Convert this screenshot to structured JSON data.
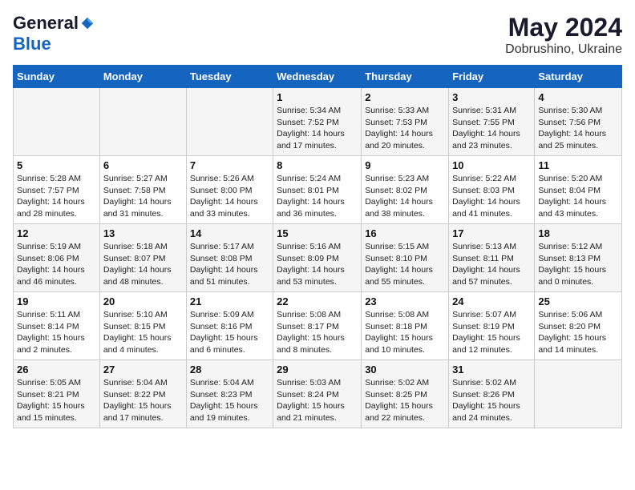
{
  "logo": {
    "general": "General",
    "blue": "Blue"
  },
  "title": "May 2024",
  "subtitle": "Dobrushino, Ukraine",
  "weekdays": [
    "Sunday",
    "Monday",
    "Tuesday",
    "Wednesday",
    "Thursday",
    "Friday",
    "Saturday"
  ],
  "weeks": [
    [
      null,
      null,
      null,
      {
        "day": "1",
        "sunrise": "Sunrise: 5:34 AM",
        "sunset": "Sunset: 7:52 PM",
        "daylight": "Daylight: 14 hours and 17 minutes."
      },
      {
        "day": "2",
        "sunrise": "Sunrise: 5:33 AM",
        "sunset": "Sunset: 7:53 PM",
        "daylight": "Daylight: 14 hours and 20 minutes."
      },
      {
        "day": "3",
        "sunrise": "Sunrise: 5:31 AM",
        "sunset": "Sunset: 7:55 PM",
        "daylight": "Daylight: 14 hours and 23 minutes."
      },
      {
        "day": "4",
        "sunrise": "Sunrise: 5:30 AM",
        "sunset": "Sunset: 7:56 PM",
        "daylight": "Daylight: 14 hours and 25 minutes."
      }
    ],
    [
      {
        "day": "5",
        "sunrise": "Sunrise: 5:28 AM",
        "sunset": "Sunset: 7:57 PM",
        "daylight": "Daylight: 14 hours and 28 minutes."
      },
      {
        "day": "6",
        "sunrise": "Sunrise: 5:27 AM",
        "sunset": "Sunset: 7:58 PM",
        "daylight": "Daylight: 14 hours and 31 minutes."
      },
      {
        "day": "7",
        "sunrise": "Sunrise: 5:26 AM",
        "sunset": "Sunset: 8:00 PM",
        "daylight": "Daylight: 14 hours and 33 minutes."
      },
      {
        "day": "8",
        "sunrise": "Sunrise: 5:24 AM",
        "sunset": "Sunset: 8:01 PM",
        "daylight": "Daylight: 14 hours and 36 minutes."
      },
      {
        "day": "9",
        "sunrise": "Sunrise: 5:23 AM",
        "sunset": "Sunset: 8:02 PM",
        "daylight": "Daylight: 14 hours and 38 minutes."
      },
      {
        "day": "10",
        "sunrise": "Sunrise: 5:22 AM",
        "sunset": "Sunset: 8:03 PM",
        "daylight": "Daylight: 14 hours and 41 minutes."
      },
      {
        "day": "11",
        "sunrise": "Sunrise: 5:20 AM",
        "sunset": "Sunset: 8:04 PM",
        "daylight": "Daylight: 14 hours and 43 minutes."
      }
    ],
    [
      {
        "day": "12",
        "sunrise": "Sunrise: 5:19 AM",
        "sunset": "Sunset: 8:06 PM",
        "daylight": "Daylight: 14 hours and 46 minutes."
      },
      {
        "day": "13",
        "sunrise": "Sunrise: 5:18 AM",
        "sunset": "Sunset: 8:07 PM",
        "daylight": "Daylight: 14 hours and 48 minutes."
      },
      {
        "day": "14",
        "sunrise": "Sunrise: 5:17 AM",
        "sunset": "Sunset: 8:08 PM",
        "daylight": "Daylight: 14 hours and 51 minutes."
      },
      {
        "day": "15",
        "sunrise": "Sunrise: 5:16 AM",
        "sunset": "Sunset: 8:09 PM",
        "daylight": "Daylight: 14 hours and 53 minutes."
      },
      {
        "day": "16",
        "sunrise": "Sunrise: 5:15 AM",
        "sunset": "Sunset: 8:10 PM",
        "daylight": "Daylight: 14 hours and 55 minutes."
      },
      {
        "day": "17",
        "sunrise": "Sunrise: 5:13 AM",
        "sunset": "Sunset: 8:11 PM",
        "daylight": "Daylight: 14 hours and 57 minutes."
      },
      {
        "day": "18",
        "sunrise": "Sunrise: 5:12 AM",
        "sunset": "Sunset: 8:13 PM",
        "daylight": "Daylight: 15 hours and 0 minutes."
      }
    ],
    [
      {
        "day": "19",
        "sunrise": "Sunrise: 5:11 AM",
        "sunset": "Sunset: 8:14 PM",
        "daylight": "Daylight: 15 hours and 2 minutes."
      },
      {
        "day": "20",
        "sunrise": "Sunrise: 5:10 AM",
        "sunset": "Sunset: 8:15 PM",
        "daylight": "Daylight: 15 hours and 4 minutes."
      },
      {
        "day": "21",
        "sunrise": "Sunrise: 5:09 AM",
        "sunset": "Sunset: 8:16 PM",
        "daylight": "Daylight: 15 hours and 6 minutes."
      },
      {
        "day": "22",
        "sunrise": "Sunrise: 5:08 AM",
        "sunset": "Sunset: 8:17 PM",
        "daylight": "Daylight: 15 hours and 8 minutes."
      },
      {
        "day": "23",
        "sunrise": "Sunrise: 5:08 AM",
        "sunset": "Sunset: 8:18 PM",
        "daylight": "Daylight: 15 hours and 10 minutes."
      },
      {
        "day": "24",
        "sunrise": "Sunrise: 5:07 AM",
        "sunset": "Sunset: 8:19 PM",
        "daylight": "Daylight: 15 hours and 12 minutes."
      },
      {
        "day": "25",
        "sunrise": "Sunrise: 5:06 AM",
        "sunset": "Sunset: 8:20 PM",
        "daylight": "Daylight: 15 hours and 14 minutes."
      }
    ],
    [
      {
        "day": "26",
        "sunrise": "Sunrise: 5:05 AM",
        "sunset": "Sunset: 8:21 PM",
        "daylight": "Daylight: 15 hours and 15 minutes."
      },
      {
        "day": "27",
        "sunrise": "Sunrise: 5:04 AM",
        "sunset": "Sunset: 8:22 PM",
        "daylight": "Daylight: 15 hours and 17 minutes."
      },
      {
        "day": "28",
        "sunrise": "Sunrise: 5:04 AM",
        "sunset": "Sunset: 8:23 PM",
        "daylight": "Daylight: 15 hours and 19 minutes."
      },
      {
        "day": "29",
        "sunrise": "Sunrise: 5:03 AM",
        "sunset": "Sunset: 8:24 PM",
        "daylight": "Daylight: 15 hours and 21 minutes."
      },
      {
        "day": "30",
        "sunrise": "Sunrise: 5:02 AM",
        "sunset": "Sunset: 8:25 PM",
        "daylight": "Daylight: 15 hours and 22 minutes."
      },
      {
        "day": "31",
        "sunrise": "Sunrise: 5:02 AM",
        "sunset": "Sunset: 8:26 PM",
        "daylight": "Daylight: 15 hours and 24 minutes."
      },
      null
    ]
  ]
}
